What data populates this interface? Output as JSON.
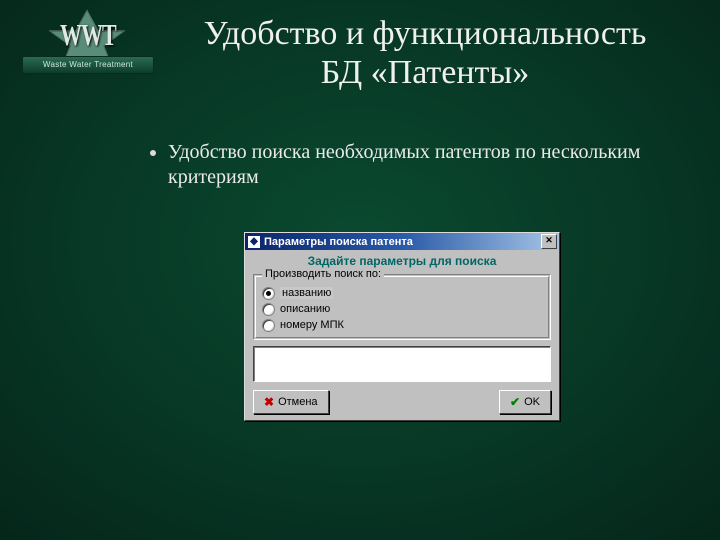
{
  "logo": {
    "monogram": "WWT",
    "ribbon": "Waste Water Treatment"
  },
  "title_line1": "Удобство и функциональность",
  "title_line2": "БД «Патенты»",
  "bullet1": "Удобство поиска необходимых патентов по нескольким критериям",
  "dialog": {
    "title": "Параметры поиска патента",
    "heading": "Задайте параметры для поиска",
    "group_label": "Производить поиск по:",
    "options": {
      "o1": "названию",
      "o2": "описанию",
      "o3": "номеру МПК"
    },
    "selected": "o1",
    "cancel": "Отмена",
    "ok": "OK",
    "close_glyph": "✕"
  }
}
